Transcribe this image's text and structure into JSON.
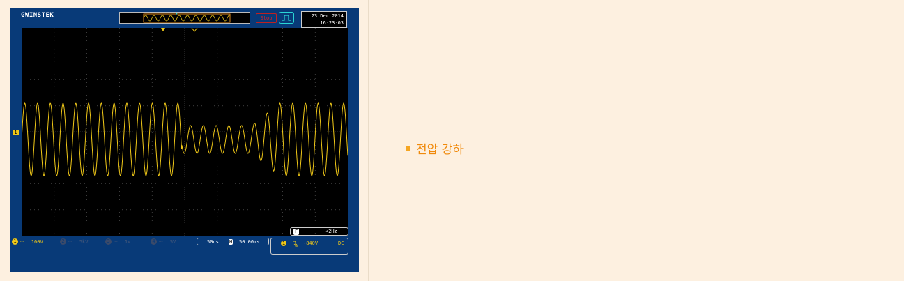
{
  "scope": {
    "brand": "GWINSTEK",
    "run_state": "Stop",
    "date": "23 Dec 2014",
    "time": "16:23:03",
    "trace_color": "#f0c818",
    "background_color": "#083a78",
    "ch1_marker": "1",
    "channels": [
      {
        "num": "1",
        "coupling": "⎓",
        "scale": "100V",
        "active": true
      },
      {
        "num": "2",
        "coupling": "⎓",
        "scale": "5kV",
        "active": false
      },
      {
        "num": "3",
        "coupling": "⎓",
        "scale": "1V",
        "active": false
      },
      {
        "num": "4",
        "coupling": "⎓",
        "scale": "5V",
        "active": false
      }
    ],
    "timebase": "50ns",
    "horizontal_position_icon": "H",
    "horizontal_position": "50.00ms",
    "trigger": {
      "channel": "1",
      "slope_icon": "falling-edge-icon",
      "level": "-840V",
      "coupling": "DC"
    },
    "frequency_label": "F",
    "frequency_value": "<2Hz"
  },
  "content": {
    "bullet_text": "전압 강하",
    "accent_color": "#f08a0c"
  }
}
